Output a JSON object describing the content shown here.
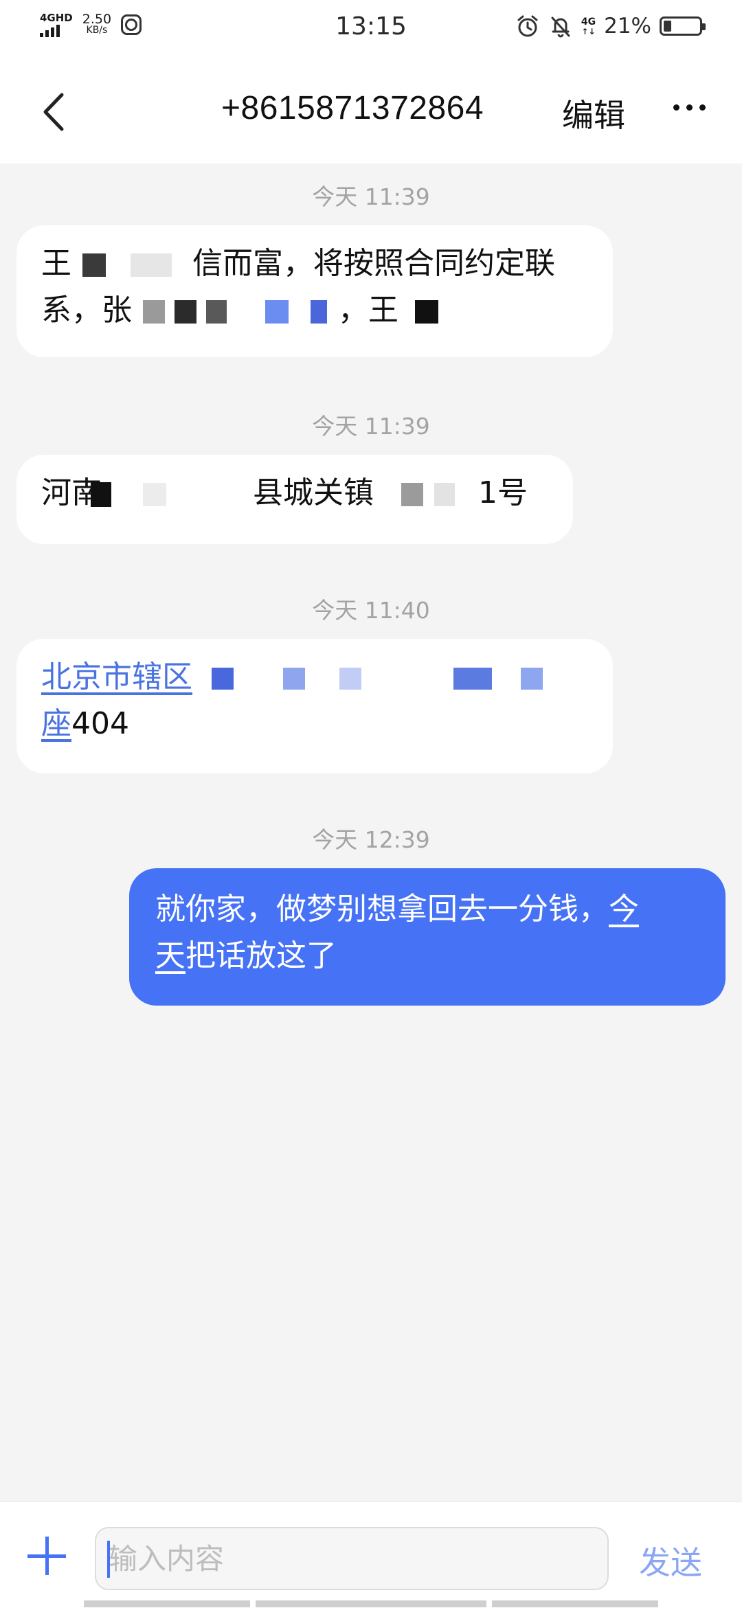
{
  "status_bar": {
    "network_type": "4GHD",
    "speed_value": "2.50",
    "speed_unit": "KB/s",
    "time": "13:15",
    "mobile_type": "4G",
    "mobile_arrows": "↑↓",
    "battery_percent": "21%",
    "battery_level": 0.21,
    "icons": [
      "signal-icon",
      "vpn-icon",
      "alarm-icon",
      "mute-bell-icon",
      "battery-icon"
    ]
  },
  "header": {
    "back_icon": "chevron-left-icon",
    "title": "+8615871372864",
    "edit_label": "编辑",
    "more_icon": "more-horizontal-icon"
  },
  "messages": [
    {
      "timestamp": "今天 11:39",
      "direction": "incoming",
      "lines": [
        {
          "a": "王",
          "b": "信而富，将按照合同约定联"
        },
        {
          "a": "系，张",
          "b": "，王"
        }
      ]
    },
    {
      "timestamp": "今天 11:39",
      "direction": "incoming",
      "lines": [
        {
          "a": "河南",
          "b": "县城关镇",
          "c": "1号"
        }
      ]
    },
    {
      "timestamp": "今天 11:40",
      "direction": "incoming",
      "lines": [
        {
          "link": "北京市辖区"
        },
        {
          "link": "座",
          "text": "404"
        }
      ]
    },
    {
      "timestamp": "今天 12:39",
      "direction": "outgoing",
      "lines": [
        {
          "text": "就你家，做梦别想拿回去一分钱，",
          "link": "今"
        },
        {
          "link": "天",
          "text": "把话放这了"
        }
      ]
    }
  ],
  "input_bar": {
    "plus_icon": "plus-icon",
    "placeholder": "输入内容",
    "value": "",
    "send_label": "发送"
  },
  "colors": {
    "accent": "#4672f6",
    "link": "#4a73e2",
    "background": "#f4f4f5",
    "bubble_in": "#ffffff",
    "timestamp": "#a3a3a6",
    "send_disabled": "#8aa6f4"
  }
}
